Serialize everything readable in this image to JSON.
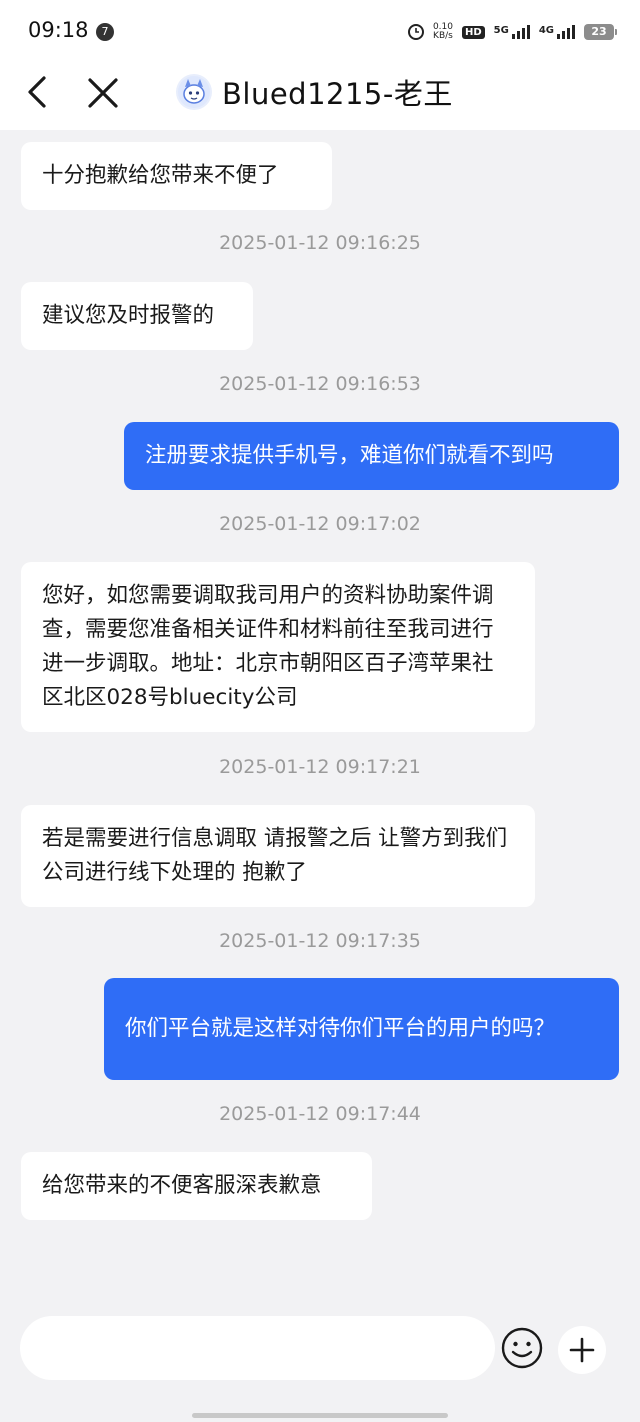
{
  "status_bar": {
    "time": "09:18",
    "notification_count": "7",
    "net_speed_value": "0.10",
    "net_speed_unit": "KB/s",
    "hd_label": "HD",
    "signal_1_label": "5G",
    "signal_2_label": "4G",
    "battery": "23"
  },
  "header": {
    "back_icon": "chevron-left-icon",
    "close_icon": "close-icon",
    "title": "Blued1215-老王"
  },
  "messages": [
    {
      "type": "in",
      "text": "十分抱歉给您带来不便了"
    },
    {
      "type": "time",
      "text": "2025-01-12 09:16:25"
    },
    {
      "type": "in",
      "text": "建议您及时报警的"
    },
    {
      "type": "time",
      "text": "2025-01-12 09:16:53"
    },
    {
      "type": "out",
      "text": "注册要求提供手机号，难道你们就看不到吗"
    },
    {
      "type": "time",
      "text": "2025-01-12 09:17:02"
    },
    {
      "type": "in",
      "text": "您好，如您需要调取我司用户的资料协助案件调查，需要您准备相关证件和材料前往至我司进行进一步调取。地址：北京市朝阳区百子湾苹果社区北区028号bluecity公司"
    },
    {
      "type": "time",
      "text": "2025-01-12 09:17:21"
    },
    {
      "type": "in",
      "text": "若是需要进行信息调取 请报警之后 让警方到我们公司进行线下处理的 抱歉了"
    },
    {
      "type": "time",
      "text": "2025-01-12 09:17:35"
    },
    {
      "type": "out",
      "text": "你们平台就是这样对待你们平台的用户的吗？"
    },
    {
      "type": "time",
      "text": "2025-01-12 09:17:44"
    },
    {
      "type": "in",
      "text": "给您带来的不便客服深表歉意"
    }
  ],
  "input_bar": {
    "placeholder": "",
    "emoji_icon": "emoji-icon",
    "plus_icon": "plus-icon"
  },
  "colors": {
    "outgoing_bubble": "#2f6df6",
    "incoming_bubble": "#ffffff",
    "background": "#f2f2f4",
    "timestamp": "#9a9a9a"
  }
}
